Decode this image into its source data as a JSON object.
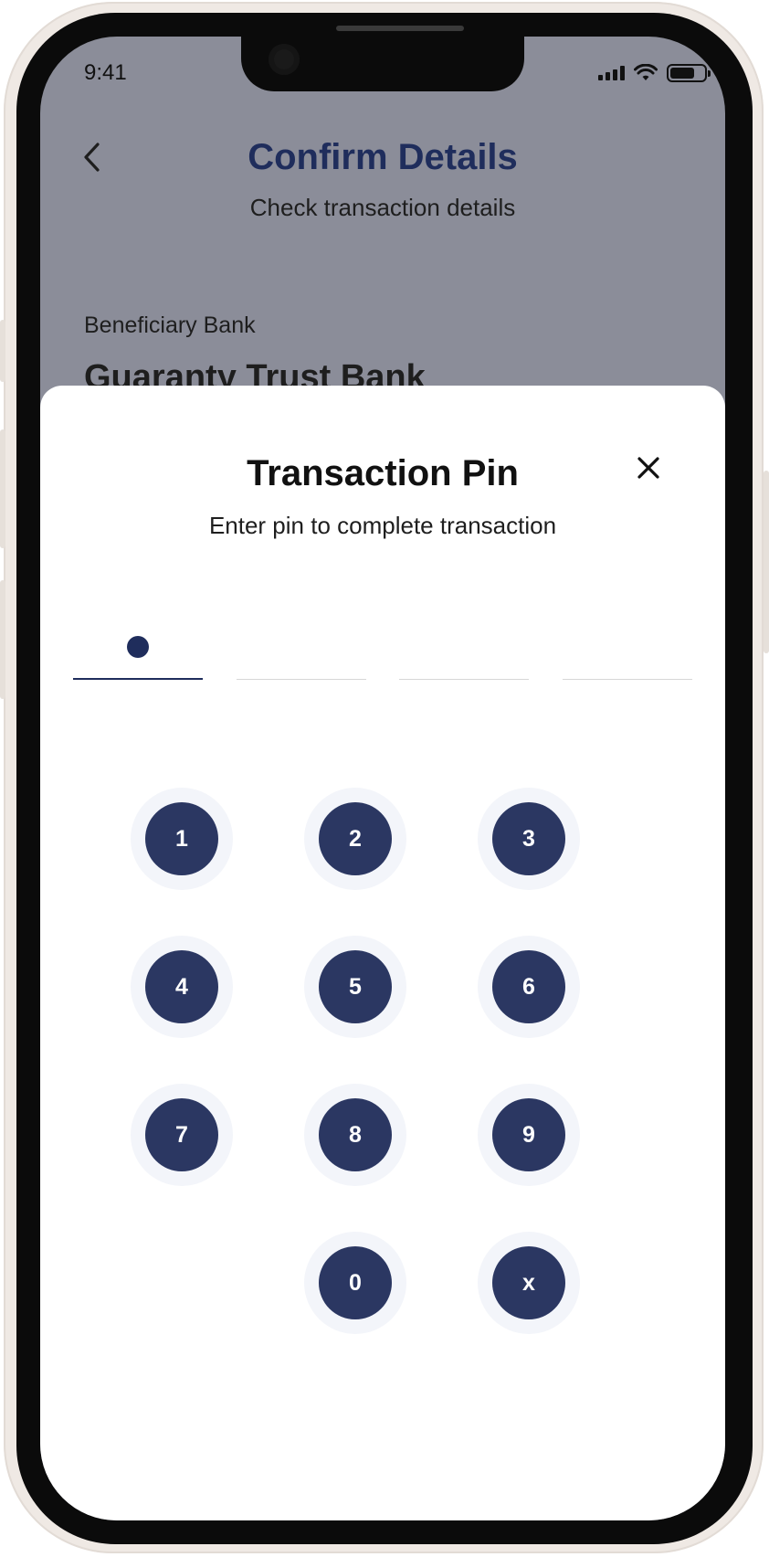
{
  "status_bar": {
    "time": "9:41"
  },
  "background_screen": {
    "title": "Confirm Details",
    "subtitle": "Check transaction details",
    "field_label": "Beneficiary Bank",
    "field_value": "Guaranty Trust Bank"
  },
  "pin_sheet": {
    "title": "Transaction Pin",
    "subtitle": "Enter pin to complete transaction",
    "pin_length": 4,
    "pin_filled": 1,
    "keys": [
      "1",
      "2",
      "3",
      "4",
      "5",
      "6",
      "7",
      "8",
      "9",
      "0",
      "x"
    ]
  },
  "colors": {
    "brand_navy": "#1f2d5c",
    "key_fill": "#2b3762",
    "overlay_bg": "#8b8d99"
  },
  "icons": {
    "back": "chevron-left-icon",
    "close": "close-icon"
  }
}
